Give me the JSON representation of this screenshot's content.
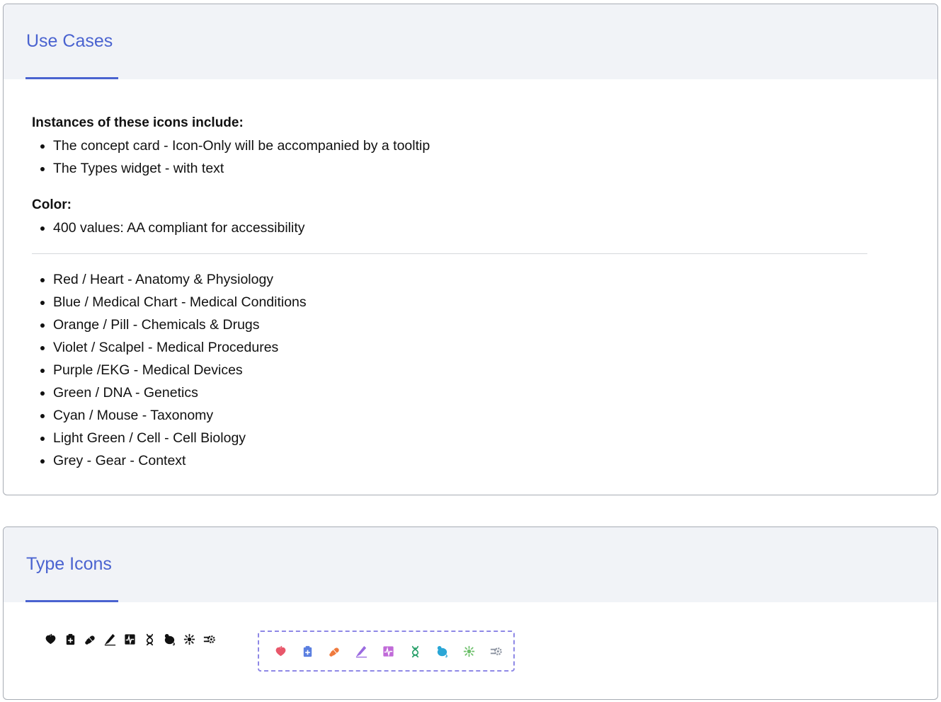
{
  "use_cases": {
    "title": "Use Cases",
    "instances_heading": "Instances of these icons include:",
    "instances": [
      "The concept card - Icon-Only will be accompanied by a tooltip",
      "The Types widget - with text"
    ],
    "color_heading": "Color:",
    "color_notes": [
      "400 values: AA compliant for accessibility"
    ],
    "type_list": [
      "Red / Heart - Anatomy & Physiology",
      "Blue / Medical Chart - Medical Conditions",
      "Orange / Pill - Chemicals & Drugs",
      "Violet / Scalpel - Medical Procedures",
      "Purple /EKG - Medical Devices",
      "Green / DNA - Genetics",
      "Cyan / Mouse - Taxonomy",
      "Light Green / Cell - Cell Biology",
      "Grey - Gear - Context"
    ]
  },
  "type_icons": {
    "title": "Type Icons",
    "icons": [
      {
        "name": "heart-icon",
        "color": "#e8576a"
      },
      {
        "name": "medical-chart-icon",
        "color": "#5b7fe0"
      },
      {
        "name": "pill-icon",
        "color": "#ef7a3d"
      },
      {
        "name": "scalpel-icon",
        "color": "#9a6ae0"
      },
      {
        "name": "ekg-icon",
        "color": "#c06ad8"
      },
      {
        "name": "dna-icon",
        "color": "#28a06a"
      },
      {
        "name": "mouse-icon",
        "color": "#2aa6d6"
      },
      {
        "name": "cell-icon",
        "color": "#6cbf6a"
      },
      {
        "name": "gear-icon",
        "color": "#8c93a0"
      }
    ],
    "mono_color": "#111111",
    "accent": "#4a63d0"
  }
}
